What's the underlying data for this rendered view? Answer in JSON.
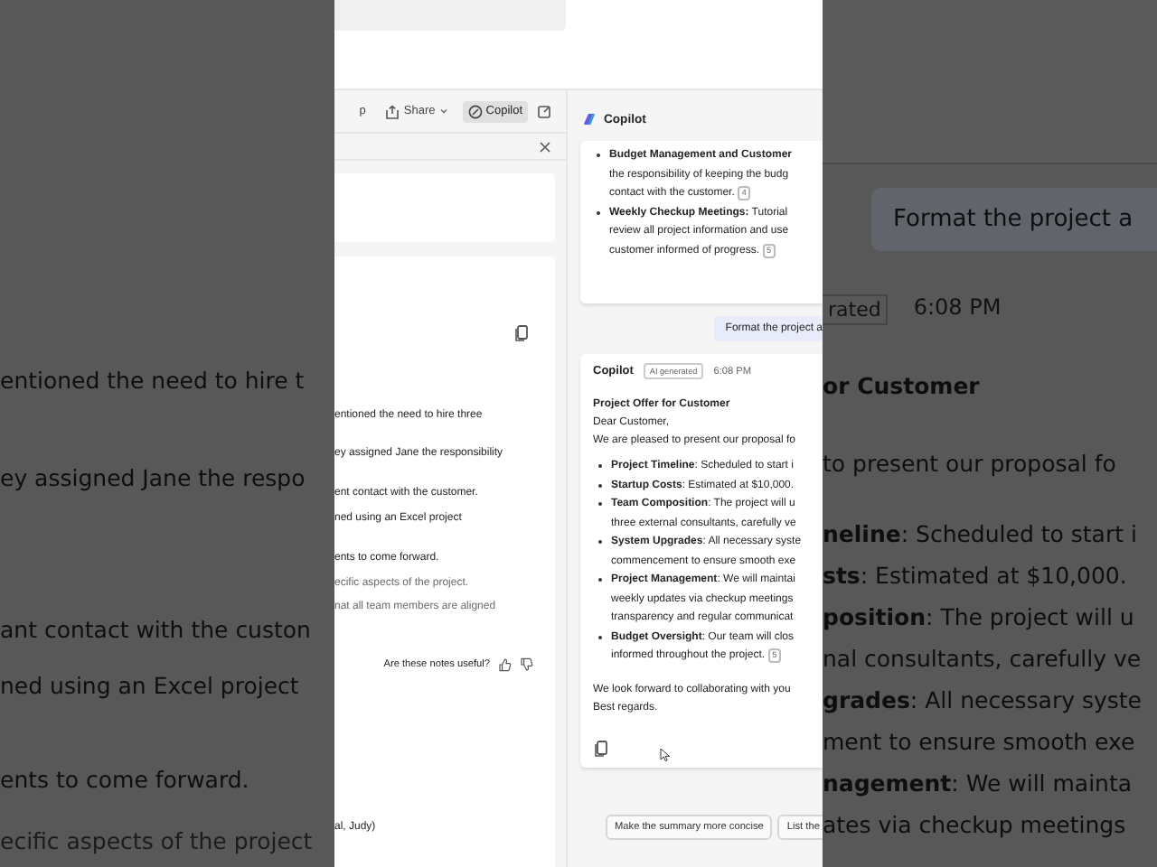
{
  "left_backdrop": {
    "lines": [
      {
        "text": "entioned the need to hire t",
        "muted": false
      },
      {
        "text": "ey assigned Jane the respo",
        "muted": false
      },
      {
        "text": "ant contact with the custon",
        "muted": false
      },
      {
        "text": "ned using an Excel project",
        "muted": false
      },
      {
        "text": "ents to come forward.",
        "muted": false
      },
      {
        "text": "ecific aspects of the project",
        "muted": true
      }
    ]
  },
  "right_backdrop": {
    "prompt": "Format the project a",
    "badge": "rated",
    "time": "6:08 PM",
    "title": "or Customer",
    "intro": "to present our proposal fo",
    "lines": [
      "**neline**: Scheduled to start i",
      "**sts**: Estimated at $10,000.",
      "**position**: The project will u",
      "nal consultants, carefully ve",
      "**grades**: All necessary syste",
      "ment to ensure smooth exe",
      "**nagement**: We will mainta",
      "ates via checkup meetings"
    ]
  },
  "toolbar": {
    "items": [
      {
        "label": "p",
        "kind": "text",
        "selected": false
      },
      {
        "label": "Share",
        "kind": "share",
        "selected": false
      },
      {
        "label": "Copilot",
        "kind": "copilot",
        "selected": true
      }
    ]
  },
  "notes": {
    "lines": [
      {
        "text": "entioned the need to hire three",
        "muted": false
      },
      {
        "text": "ey assigned Jane the responsibility",
        "muted": false
      },
      {
        "text": "ent contact with the customer.",
        "muted": false
      },
      {
        "text": "ned using an Excel project",
        "muted": false
      },
      {
        "text": "ents to come forward.",
        "muted": false
      },
      {
        "text": "ecific aspects of the project.",
        "muted": true
      },
      {
        "text": "nat all team members are aligned",
        "muted": true
      }
    ],
    "feedback": "Are these notes useful?",
    "footer": "al, Judy)"
  },
  "copilot": {
    "title": "Copilot",
    "earlier": [
      {
        "lines": [
          "**Budget Management and Customer**",
          "the responsibility of keeping the budg",
          "contact with the customer."
        ],
        "ref": "4"
      },
      {
        "lines": [
          "**Weekly Checkup Meetings:** Tutorial",
          "review all project information and use",
          "customer informed of progress."
        ],
        "ref": "5"
      }
    ],
    "prompt": "Format the project a",
    "reply": {
      "author": "Copilot",
      "badge": "AI generated",
      "time": "6:08 PM",
      "title": "Project Offer for Customer",
      "greeting": "Dear Customer,",
      "intro": "We are pleased to present our proposal fo",
      "bullets": [
        {
          "lines": [
            "**Project Timeline**: Scheduled to start i"
          ]
        },
        {
          "lines": [
            "**Startup Costs**: Estimated at $10,000."
          ]
        },
        {
          "lines": [
            "**Team Composition**: The project will u",
            "three external consultants, carefully ve"
          ]
        },
        {
          "lines": [
            "**System Upgrades**: All necessary syste",
            "commencement to ensure smooth exe"
          ]
        },
        {
          "lines": [
            "**Project Management**: We will maintai",
            "weekly updates via checkup meetings",
            "transparency and regular communicat"
          ]
        },
        {
          "lines": [
            "**Budget Oversight**: Our team will clos",
            "informed throughout the project."
          ],
          "ref": "5"
        }
      ],
      "closing": "We look forward to collaborating with you",
      "signoff": "Best regards."
    },
    "suggestions": [
      "Make the summary more concise",
      "List the"
    ]
  }
}
